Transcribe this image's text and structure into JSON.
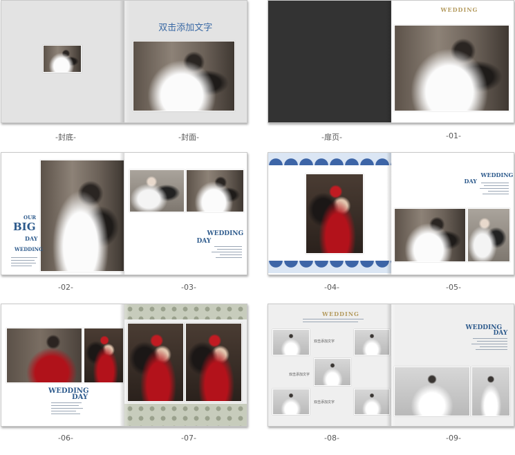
{
  "spreads": [
    {
      "caption_left": "-封底-",
      "caption_right": "-封面-",
      "cover_title": "双击添加文字"
    },
    {
      "caption_left": "-扉页-",
      "caption_right": "-01-",
      "heading": "WEDDING"
    },
    {
      "caption_left": "-02-",
      "caption_right": "-03-",
      "our": "OUR",
      "big": "BIG",
      "day": "DAY",
      "wedding": "WEDDING",
      "wedding2": "WEDDING",
      "day2": "DAY"
    },
    {
      "caption_left": "-04-",
      "caption_right": "-05-",
      "wedding": "WEDDING",
      "day": "DAY"
    },
    {
      "caption_left": "-06-",
      "caption_right": "-07-",
      "wedding": "WEDDING",
      "day": "DAY"
    },
    {
      "caption_left": "-08-",
      "caption_right": "-09-",
      "heading": "WEDDING",
      "wedding": "WEDDING",
      "day": "DAY",
      "placeholders": [
        "双击添加文字",
        "双击添加文字",
        "双击添加文字",
        "双击添加文字"
      ]
    }
  ]
}
